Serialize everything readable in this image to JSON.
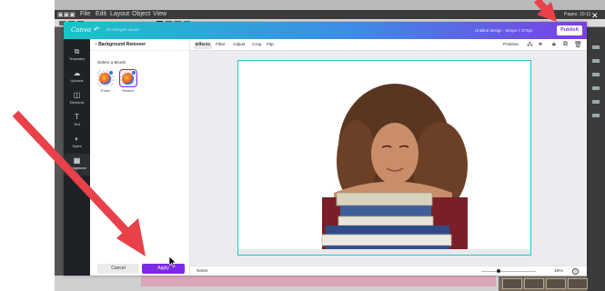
{
  "bg_app": {
    "menu": [
      "File",
      "Edit",
      "Layout",
      "Object",
      "View"
    ],
    "pages_label": "Pages: 10-11"
  },
  "canva": {
    "logo": "Canva",
    "all_saved": "All changes saved",
    "design_title": "Untitled design - 561px × 374px",
    "publish_label": "Publish",
    "sidenav": [
      {
        "label": "Templates",
        "icon": "templates-icon"
      },
      {
        "label": "Uploads",
        "icon": "upload-cloud-icon"
      },
      {
        "label": "Elements",
        "icon": "elements-icon"
      },
      {
        "label": "Text",
        "icon": "text-icon"
      },
      {
        "label": "Styles",
        "icon": "palette-icon"
      },
      {
        "label": "Background",
        "icon": "background-icon"
      }
    ],
    "panel": {
      "title": "Background Remover",
      "select_brush": "Select a Brush",
      "brushes": [
        {
          "label": "Erase"
        },
        {
          "label": "Restore"
        }
      ],
      "cancel_label": "Cancel",
      "apply_label": "Apply"
    },
    "editor": {
      "tabs": [
        "Effects",
        "Filter",
        "Adjust",
        "Crop",
        "Flip"
      ],
      "active_tab": "Effects",
      "position_label": "Position",
      "notes_label": "Notes",
      "zoom_label": "19%",
      "zoom_value": 0.19,
      "help_label": "?"
    },
    "colors": {
      "accent": "#7d2ae8",
      "canvas_border": "#26c6c8",
      "topbar_start": "#19c4c6",
      "topbar_end": "#7b3fe4",
      "annotation_arrow": "#e8414a"
    }
  }
}
